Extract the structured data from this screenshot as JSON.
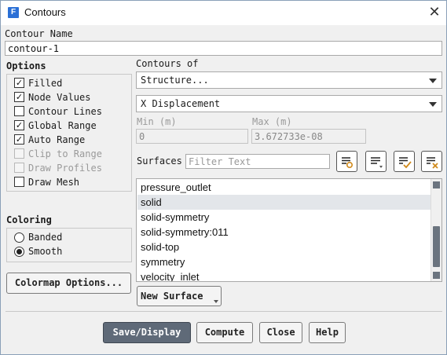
{
  "window": {
    "title": "Contours",
    "app_icon_letter": "F",
    "close_glyph": "✕"
  },
  "contour_name": {
    "label": "Contour Name",
    "value": "contour-1"
  },
  "options": {
    "label": "Options",
    "items": [
      {
        "label": "Filled",
        "checked": true,
        "enabled": true
      },
      {
        "label": "Node Values",
        "checked": true,
        "enabled": true
      },
      {
        "label": "Contour Lines",
        "checked": false,
        "enabled": true
      },
      {
        "label": "Global Range",
        "checked": true,
        "enabled": true
      },
      {
        "label": "Auto Range",
        "checked": true,
        "enabled": true
      },
      {
        "label": "Clip to Range",
        "checked": false,
        "enabled": false
      },
      {
        "label": "Draw Profiles",
        "checked": false,
        "enabled": false
      },
      {
        "label": "Draw Mesh",
        "checked": false,
        "enabled": true
      }
    ]
  },
  "coloring": {
    "label": "Coloring",
    "options": [
      {
        "label": "Banded",
        "selected": false
      },
      {
        "label": "Smooth",
        "selected": true
      }
    ]
  },
  "colormap_button": "Colormap Options...",
  "contours_of": {
    "label": "Contours of",
    "category": "Structure...",
    "quantity": "X Displacement"
  },
  "range": {
    "min_label": "Min (m)",
    "min_value": "0",
    "max_label": "Max (m)",
    "max_value": "3.672733e-08"
  },
  "surfaces": {
    "label": "Surfaces",
    "filter_placeholder": "Filter Text",
    "items": [
      {
        "label": "pressure_outlet",
        "selected": false
      },
      {
        "label": "solid",
        "selected": true
      },
      {
        "label": "solid-symmetry",
        "selected": false
      },
      {
        "label": "solid-symmetry:011",
        "selected": false
      },
      {
        "label": "solid-top",
        "selected": false
      },
      {
        "label": "symmetry",
        "selected": false
      },
      {
        "label": "velocity_inlet",
        "selected": false
      }
    ],
    "icons": [
      "select-by-type-icon",
      "list-options-icon",
      "select-all-icon",
      "deselect-all-icon"
    ]
  },
  "new_surface_button": "New Surface",
  "footer": {
    "save_display": "Save/Display",
    "compute": "Compute",
    "close": "Close",
    "help": "Help"
  },
  "colors": {
    "primary_button": "#5f6a78",
    "selection": "#e3e6ea",
    "icon_blue": "#2a6fd6",
    "icon_orange": "#d08a1c"
  }
}
